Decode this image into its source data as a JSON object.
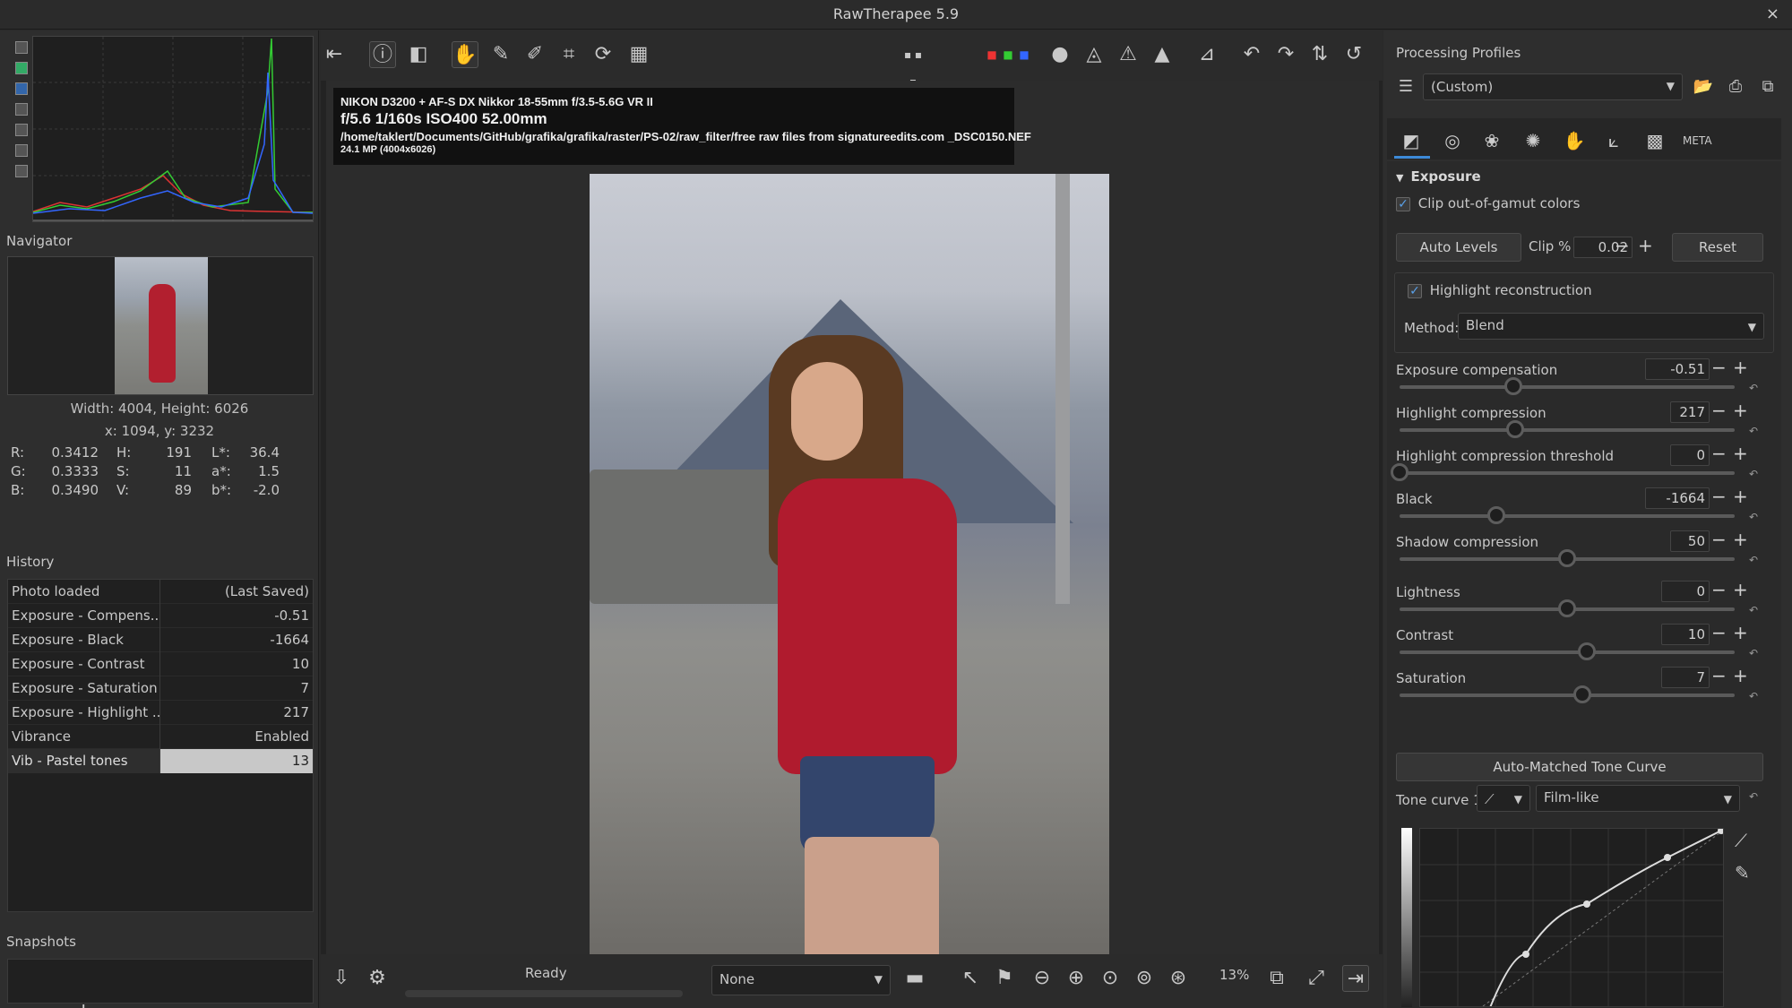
{
  "window": {
    "title": "RawTherapee 5.9",
    "close": "×"
  },
  "left": {
    "navigator_title": "Navigator",
    "size_text": "Width: 4004, Height: 6026",
    "coords_text": "x: 1094, y: 3232",
    "picker": [
      {
        "l1": "R:",
        "v1": "0.3412",
        "l2": "H:",
        "v2": "191",
        "l3": "L*:",
        "v3": "36.4"
      },
      {
        "l1": "G:",
        "v1": "0.3333",
        "l2": "S:",
        "v2": "11",
        "l3": "a*:",
        "v3": "1.5"
      },
      {
        "l1": "B:",
        "v1": "0.3490",
        "l2": "V:",
        "v2": "89",
        "l3": "b*:",
        "v3": "-2.0"
      }
    ],
    "history_title": "History",
    "history": [
      {
        "name": "Photo loaded",
        "value": "(Last Saved)"
      },
      {
        "name": "Exposure - Compens...",
        "value": "-0.51"
      },
      {
        "name": "Exposure - Black",
        "value": "-1664"
      },
      {
        "name": "Exposure - Contrast",
        "value": "10"
      },
      {
        "name": "Exposure - Saturation",
        "value": "7"
      },
      {
        "name": "Exposure - Highlight ...",
        "value": "217"
      },
      {
        "name": "Vibrance",
        "value": "Enabled"
      },
      {
        "name": "Vib - Pastel tones",
        "value": "13"
      }
    ],
    "snapshots_title": "Snapshots",
    "snap_add": "+",
    "snap_remove": "−"
  },
  "exif": {
    "line1": "NIKON D3200 + AF-S DX Nikkor 18-55mm f/3.5-5.6G VR II",
    "line2": "f/5.6  1/160s  ISO400  52.00mm",
    "line3": "/home/taklert/Documents/GitHub/grafika/grafika/raster/PS-02/raw_filter/free raw files from signatureedits.com _DSC0150.NEF",
    "line4": "24.1 MP (4004x6026)"
  },
  "status": {
    "text": "Ready",
    "detail_combo": "None",
    "zoom": "13%"
  },
  "right": {
    "profiles_title": "Processing Profiles",
    "profile_value": "(Custom)",
    "exposure_title": "Exposure",
    "clip_gamut_label": "Clip out-of-gamut colors",
    "auto_levels": "Auto Levels",
    "clip_label": "Clip %",
    "clip_value": "0.02",
    "reset": "Reset",
    "hl_recon_label": "Highlight reconstruction",
    "method_label": "Method:",
    "method_value": "Blend",
    "sliders": [
      {
        "label": "Exposure compensation",
        "value": "-0.51",
        "pos": 0.34
      },
      {
        "label": "Highlight compression",
        "value": "217",
        "pos": 0.345
      },
      {
        "label": "Highlight compression threshold",
        "value": "0",
        "pos": 0.0
      },
      {
        "label": "Black",
        "value": "-1664",
        "pos": 0.29
      },
      {
        "label": "Shadow compression",
        "value": "50",
        "pos": 0.5
      },
      {
        "label": "Lightness",
        "value": "0",
        "pos": 0.5
      },
      {
        "label": "Contrast",
        "value": "10",
        "pos": 0.56
      },
      {
        "label": "Saturation",
        "value": "7",
        "pos": 0.545
      }
    ],
    "auto_matched": "Auto-Matched Tone Curve",
    "tone_curve_label": "Tone curve 1:",
    "tone_curve_mode": "Film-like"
  }
}
